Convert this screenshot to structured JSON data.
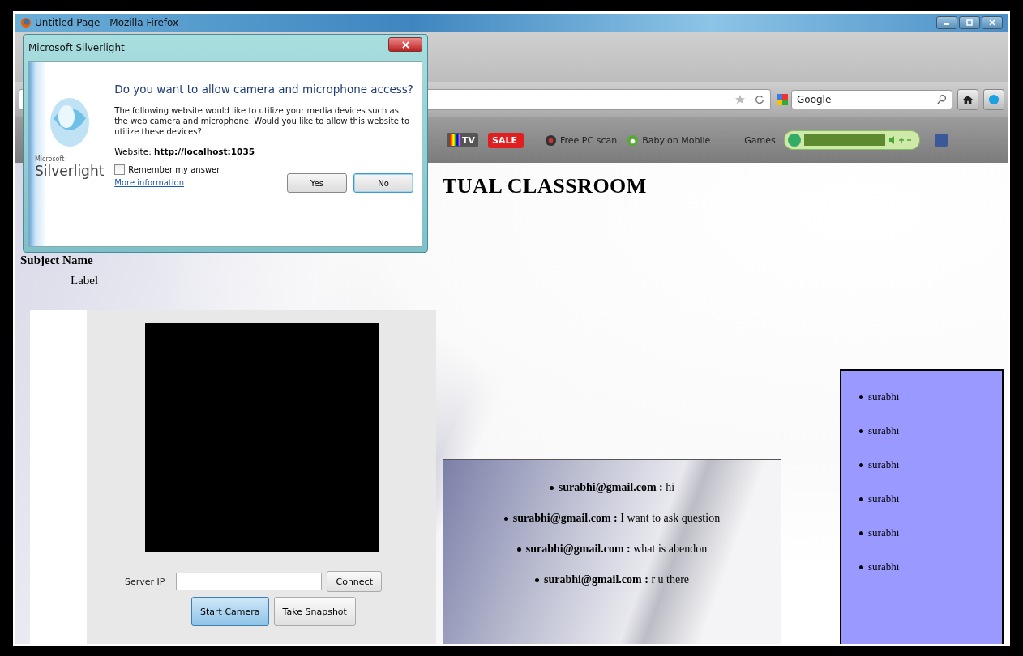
{
  "window": {
    "title": "Untitled Page - Mozilla Firefox"
  },
  "search": {
    "placeholder": "Google"
  },
  "bookmarks": [
    {
      "kind": "tv",
      "label": "TV"
    },
    {
      "kind": "sale",
      "label": "SALE"
    },
    {
      "kind": "scan",
      "label": "Free PC scan"
    },
    {
      "kind": "babylon",
      "label": "Babylon Mobile"
    },
    {
      "kind": "games",
      "label": "Games"
    },
    {
      "kind": "facebook"
    }
  ],
  "dialog": {
    "title": "Microsoft Silverlight",
    "brand_small": "Microsoft",
    "brand": "Silverlight",
    "heading": "Do you want to allow camera and microphone access?",
    "message": "The following website would like to utilize your media devices such as the web camera and microphone. Would you like to allow this website to utilize these devices?",
    "website": "Website: **http://localhost:1035**",
    "remember": {
      "label": "Remember my answer",
      "checked": false
    },
    "link": "More information",
    "buttons": [
      {
        "label": "Yes",
        "focused": false
      },
      {
        "label": "No",
        "focused": true
      }
    ]
  },
  "page": {
    "heading": "TUAL CLASSROOM",
    "labels": [
      "Subject Name",
      "Label"
    ],
    "camera": {
      "server_label": "Server IP",
      "connect": "Connect",
      "buttons": [
        {
          "label": "Start Camera",
          "focused": true
        },
        {
          "label": "Take Snapshot",
          "focused": false
        }
      ]
    },
    "messages": [
      {
        "text": "**surabhi@gmail.com :** hi"
      },
      {
        "text": "**surabhi@gmail.com :** I want to ask question"
      },
      {
        "text": "**surabhi@gmail.com :** what is abendon"
      },
      {
        "text": "**surabhi@gmail.com :** r u there"
      }
    ],
    "users": [
      "surabhi",
      "surabhi",
      "surabhi",
      "surabhi",
      "surabhi",
      "surabhi"
    ]
  }
}
